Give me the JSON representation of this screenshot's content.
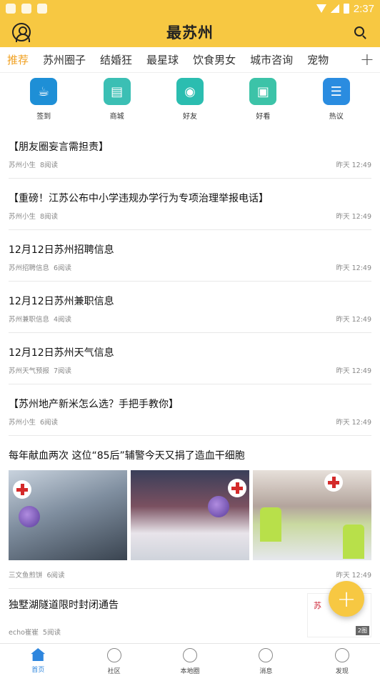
{
  "status": {
    "time": "2:37"
  },
  "header": {
    "logo": "最苏州"
  },
  "tabs": [
    "推荐",
    "苏州圈子",
    "结婚狂",
    "最星球",
    "饮食男女",
    "城市咨询",
    "宠物"
  ],
  "tabs_plus": "+",
  "quick": [
    {
      "label": "签到",
      "icon": "coffee-cup-icon",
      "color": "#1e8fd6"
    },
    {
      "label": "商城",
      "icon": "store-icon",
      "color": "#3bbfb4"
    },
    {
      "label": "好友",
      "icon": "friend-icon",
      "color": "#2bbdb0"
    },
    {
      "label": "好看",
      "icon": "tv-icon",
      "color": "#3cc3a8"
    },
    {
      "label": "热议",
      "icon": "clipboard-icon",
      "color": "#2a8ce0"
    }
  ],
  "feed": [
    {
      "title": "【朋友圈妄言需担责】",
      "author": "苏州小生",
      "reads": "8阅读",
      "time": "昨天 12:49"
    },
    {
      "title": "【重磅！江苏公布中小学违规办学行为专项治理举报电话】",
      "author": "苏州小生",
      "reads": "8阅读",
      "time": "昨天 12:49"
    },
    {
      "title": "12月12日苏州招聘信息",
      "author": "苏州招聘信息",
      "reads": "6阅读",
      "time": "昨天 12:49"
    },
    {
      "title": "12月12日苏州兼职信息",
      "author": "苏州兼职信息",
      "reads": "4阅读",
      "time": "昨天 12:49"
    },
    {
      "title": "12月12日苏州天气信息",
      "author": "苏州天气预报",
      "reads": "7阅读",
      "time": "昨天 12:49"
    },
    {
      "title": "【苏州地产新米怎么选？手把手教你】",
      "author": "苏州小生",
      "reads": "6阅读",
      "time": "昨天 12:49"
    }
  ],
  "photo_post": {
    "title": "每年献血两次 这位“85后”辅警今天又捐了造血干细胞",
    "author": "三文鱼煎饼",
    "reads": "6阅读",
    "time": "昨天 12:49"
  },
  "thumb_post": {
    "title": "独墅湖隧道限时封闭通告",
    "author": "echo崔崔",
    "reads": "5阅读",
    "thumb_title": "苏 州 局",
    "thumb_count": "2图"
  },
  "fab_label": "+",
  "bottom_nav": [
    {
      "label": "首页"
    },
    {
      "label": "社区"
    },
    {
      "label": "本地圈"
    },
    {
      "label": "消息"
    },
    {
      "label": "发现"
    }
  ],
  "colors": {
    "accent": "#f7c842",
    "active_tab": "#f0a020",
    "nav_active": "#2e86de"
  }
}
